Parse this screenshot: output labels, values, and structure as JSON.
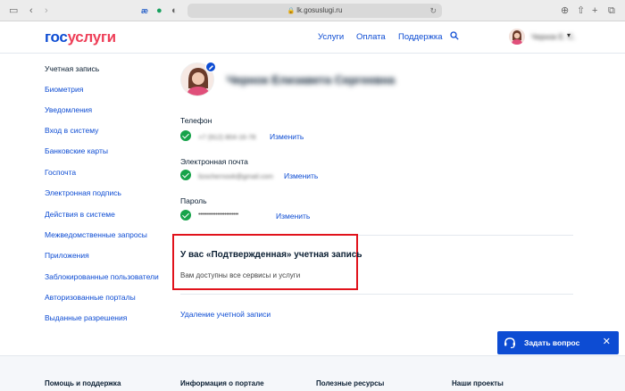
{
  "browser": {
    "url": "lk.gosuslugi.ru",
    "icons": [
      "sidebar-icon",
      "back-icon",
      "forward-icon",
      "translate-icon",
      "evernote-icon",
      "shield-icon",
      "download-icon",
      "share-icon",
      "add-tab-icon",
      "tabs-icon"
    ]
  },
  "header": {
    "logo_part1": "гос",
    "logo_part2": "услуги",
    "nav": [
      "Услуги",
      "Оплата",
      "Поддержка"
    ],
    "user_name": "Чернок Е. С."
  },
  "sidebar": {
    "items": [
      "Учетная запись",
      "Биометрия",
      "Уведомления",
      "Вход в систему",
      "Банковские карты",
      "Госпочта",
      "Электронная подпись",
      "Действия в системе",
      "Межведомственные запросы",
      "Приложения",
      "Заблокированные пользователи",
      "Авторизованные порталы",
      "Выданные разрешения"
    ]
  },
  "profile": {
    "full_name": "Чернок Елизавета Сергеевна",
    "phone": {
      "label": "Телефон",
      "value": "+7 (912) 804-16-78",
      "action": "Изменить"
    },
    "email": {
      "label": "Электронная почта",
      "value": "lizochernook@gmail.com",
      "action": "Изменить"
    },
    "password": {
      "label": "Пароль",
      "value": "•••••••••••••••••••••••",
      "action": "Изменить"
    },
    "status_title": "У вас «Подтвержденная» учетная запись",
    "status_desc": "Вам доступны все сервисы и услуги",
    "delete_link": "Удаление учетной записи"
  },
  "chat": {
    "label": "Задать вопрос"
  },
  "footer": {
    "headings": [
      "Помощь и поддержка",
      "Информация о портале",
      "Полезные ресурсы",
      "Наши проекты"
    ]
  },
  "colors": {
    "brand_blue": "#0d4cd3",
    "brand_red": "#ee3f58",
    "success": "#17a34a",
    "highlight": "#e1121b"
  }
}
